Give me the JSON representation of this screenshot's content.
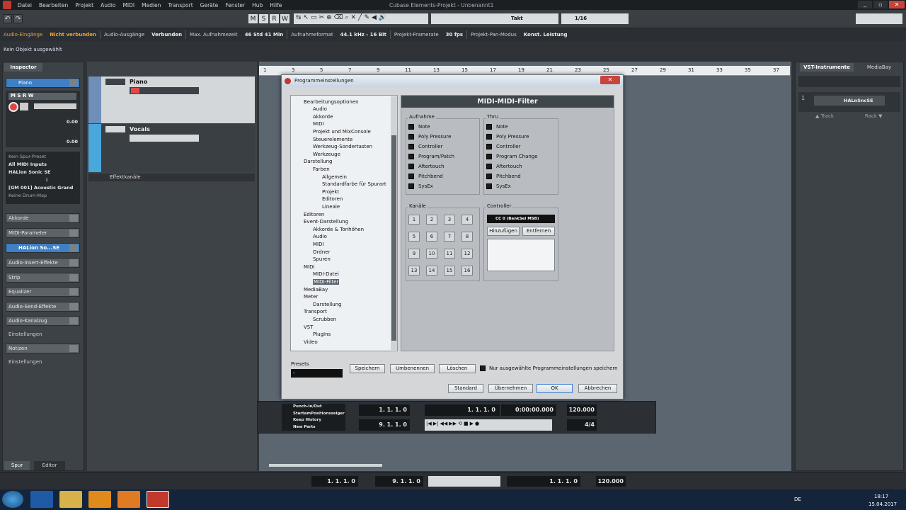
{
  "app": {
    "window_title": "Cubase Elements-Projekt - Unbenannt1"
  },
  "menu": [
    "Datei",
    "Bearbeiten",
    "Projekt",
    "Audio",
    "MIDI",
    "Medien",
    "Transport",
    "Geräte",
    "Fenster",
    "Hub",
    "Hilfe"
  ],
  "toolbar": {
    "m": "M",
    "s": "S",
    "r": "R",
    "w": "W",
    "snap_mode": "Takt",
    "quantize": "1/16"
  },
  "status": {
    "audio_in_label": "Audio-Eingänge",
    "audio_in_value": "Nicht verbunden",
    "audio_out_label": "Audio-Ausgänge",
    "audio_out_value": "Verbunden",
    "max_rec_label": "Max. Aufnahmezeit",
    "max_rec_value": "46 Std 41 Min",
    "rec_format_label": "Aufnahmeformat",
    "rec_format_value": "44.1 kHz - 16 Bit",
    "framerate_label": "Projekt-Framerate",
    "framerate_value": "30 fps",
    "panmode_label": "Projekt-Pan-Modus",
    "panmode_value": "Konst. Leistung"
  },
  "info_line": "Kein Objekt ausgewählt",
  "inspector": {
    "tab": "Inspector",
    "track_name": "Piano",
    "val1": "0.00",
    "val2": "0.00",
    "preset": "Kein Spur-Preset",
    "midi_in": "All MIDI Inputs",
    "instrument": "HALion Sonic SE",
    "channel": "1",
    "program": "[GM 001] Acoustic Grand",
    "drummap": "Keine Drum-Map",
    "sections": [
      "Akkorde",
      "MIDI-Parameter",
      "HALion So...SE",
      "Audio-Insert-Effekte",
      "Strip",
      "Equalizer",
      "Audio-Send-Effekte",
      "Audio-Kanalzug",
      "Einstellungen",
      "Notizen",
      "Einstellungen"
    ],
    "tab_spur": "Spur",
    "tab_editor": "Editor"
  },
  "tracks": [
    {
      "name": "Piano"
    },
    {
      "name": "Vocals"
    }
  ],
  "fx_channel": "Effektkanäle",
  "ruler": [
    "1",
    "3",
    "5",
    "7",
    "9",
    "11",
    "13",
    "15",
    "17",
    "19",
    "21",
    "23",
    "25",
    "27",
    "29",
    "31",
    "33",
    "35",
    "37"
  ],
  "right_panel": {
    "tab_vst": "VST-Instrumente",
    "tab_media": "MediaBay",
    "instrument": "HALnSncSE",
    "track_label": "▲ Track",
    "rack_label": "Rack ▼",
    "slot": "1"
  },
  "dialog": {
    "title": "Programmeinstellungen",
    "header": "MIDI-MIDI-Filter",
    "tree": [
      {
        "t": "MIDI",
        "l": 1
      },
      {
        "t": "Bearbeitungsoptionen",
        "l": 0
      },
      {
        "t": "Audio",
        "l": 1
      },
      {
        "t": "Akkorde",
        "l": 1
      },
      {
        "t": "MIDI",
        "l": 1
      },
      {
        "t": "Projekt und MixConsole",
        "l": 1
      },
      {
        "t": "Steuerelemente",
        "l": 1
      },
      {
        "t": "Werkzeug-Sondertasten",
        "l": 1
      },
      {
        "t": "Werkzeuge",
        "l": 1
      },
      {
        "t": "Darstellung",
        "l": 0
      },
      {
        "t": "Farben",
        "l": 1
      },
      {
        "t": "Allgemein",
        "l": 2
      },
      {
        "t": "Standardfarbe für Spurart",
        "l": 2
      },
      {
        "t": "Projekt",
        "l": 2
      },
      {
        "t": "Editoren",
        "l": 2
      },
      {
        "t": "Lineale",
        "l": 2
      },
      {
        "t": "Editoren",
        "l": 0
      },
      {
        "t": "Event-Darstellung",
        "l": 0
      },
      {
        "t": "Akkorde & Tonhöhen",
        "l": 1
      },
      {
        "t": "Audio",
        "l": 1
      },
      {
        "t": "MIDI",
        "l": 1
      },
      {
        "t": "Ordner",
        "l": 1
      },
      {
        "t": "Spuren",
        "l": 1
      },
      {
        "t": "MIDI",
        "l": 0
      },
      {
        "t": "MIDI-Datei",
        "l": 1
      },
      {
        "t": "MIDI-Filter",
        "l": 1,
        "sel": true
      },
      {
        "t": "MediaBay",
        "l": 0
      },
      {
        "t": "Meter",
        "l": 0
      },
      {
        "t": "Darstellung",
        "l": 1
      },
      {
        "t": "Transport",
        "l": 0
      },
      {
        "t": "Scrubben",
        "l": 1
      },
      {
        "t": "VST",
        "l": 0
      },
      {
        "t": "PlugIns",
        "l": 1
      },
      {
        "t": "Video",
        "l": 0
      }
    ],
    "aufnahme_label": "Aufnahme",
    "aufnahme": [
      "Note",
      "Poly Pressure",
      "Controller",
      "Program/Patch",
      "Aftertouch",
      "Pitchbend",
      "SysEx"
    ],
    "thru_label": "Thru",
    "thru": [
      "Note",
      "Poly Pressure",
      "Controller",
      "Program Change",
      "Aftertouch",
      "Pitchbend",
      "SysEx"
    ],
    "kanaele_label": "Kanäle",
    "channels": [
      "1",
      "2",
      "3",
      "4",
      "5",
      "6",
      "7",
      "8",
      "9",
      "10",
      "11",
      "12",
      "13",
      "14",
      "15",
      "16"
    ],
    "controller_label": "Controller",
    "controller_value": "CC 0  (BankSel MSB)",
    "add": "Hinzufügen",
    "remove": "Entfernen",
    "presets_label": "Presets",
    "preset_value": "-",
    "save": "Speichern",
    "rename": "Umbenennen",
    "delete": "Löschen",
    "only_selected": "Nur ausgewählte Programmeinstellungen speichern",
    "standard": "Standard",
    "apply": "Übernehmen",
    "ok": "OK",
    "cancel": "Abbrechen"
  },
  "transport": {
    "punch": "Punch-In/Out",
    "start_pos": "StartamPositionszeiger",
    "keep": "Keep History",
    "new_parts": "New Parts",
    "left_loc": "1. 1. 1.   0",
    "right_loc": "9. 1. 1.   0",
    "pos_bars": "1. 1. 1.   0",
    "pos_time": "0:00:00.000",
    "tempo": "120.000",
    "signature": "4/4"
  },
  "bottom": {
    "left": "1. 1. 1.   0",
    "right": "9. 1. 1.   0",
    "pos": "1. 1. 1.   0",
    "tempo": "120.000"
  },
  "taskbar": {
    "lang": "DE",
    "time": "18:17",
    "date": "15.04.2017"
  }
}
